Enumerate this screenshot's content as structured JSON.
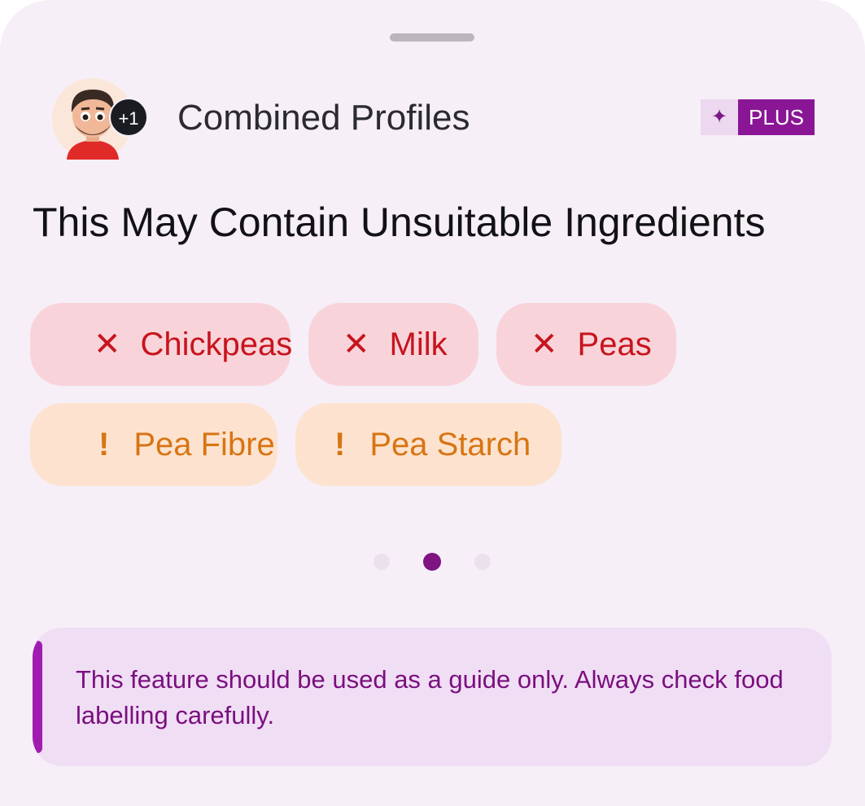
{
  "header": {
    "title": "Combined Profiles",
    "extra_profiles_badge": "+1",
    "plus_badge": {
      "icon": "sparkle-icon",
      "label": "PLUS"
    }
  },
  "headline": "This May Contain Unsuitable Ingredients",
  "ingredients": [
    {
      "mark": "✕",
      "label": "Chickpeas",
      "severity": "unsuitable"
    },
    {
      "mark": "✕",
      "label": "Milk",
      "severity": "unsuitable"
    },
    {
      "mark": "✕",
      "label": "Peas",
      "severity": "unsuitable"
    },
    {
      "mark": "!",
      "label": "Pea Fibre",
      "severity": "caution"
    },
    {
      "mark": "!",
      "label": "Pea Starch",
      "severity": "caution"
    }
  ],
  "pagination": {
    "pages": 3,
    "active_index": 1
  },
  "disclaimer": "This feature should be used as a guide only. Always check food labelling carefully.",
  "colors": {
    "accent": "#8a1696",
    "unsuitable_text": "#c8141d",
    "unsuitable_bg": "#f8d4da",
    "caution_text": "#d77513",
    "caution_bg": "#fde3cf"
  }
}
